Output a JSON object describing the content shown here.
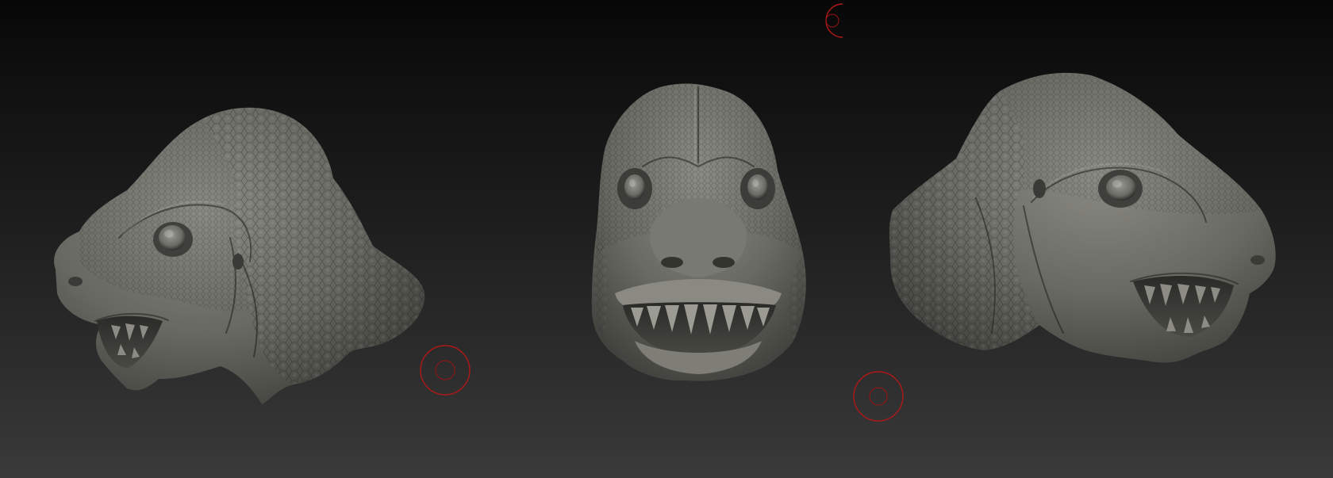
{
  "viewport": {
    "background_top": "#070707",
    "background_bottom": "#3a3a3a"
  },
  "models": [
    {
      "name": "dinosaur-head-left-view",
      "color": "#6a6a64"
    },
    {
      "name": "dinosaur-head-front-view",
      "color": "#6b6b65"
    },
    {
      "name": "dinosaur-head-right-view",
      "color": "#6a6a64"
    }
  ],
  "cursor_color": "#b01818"
}
